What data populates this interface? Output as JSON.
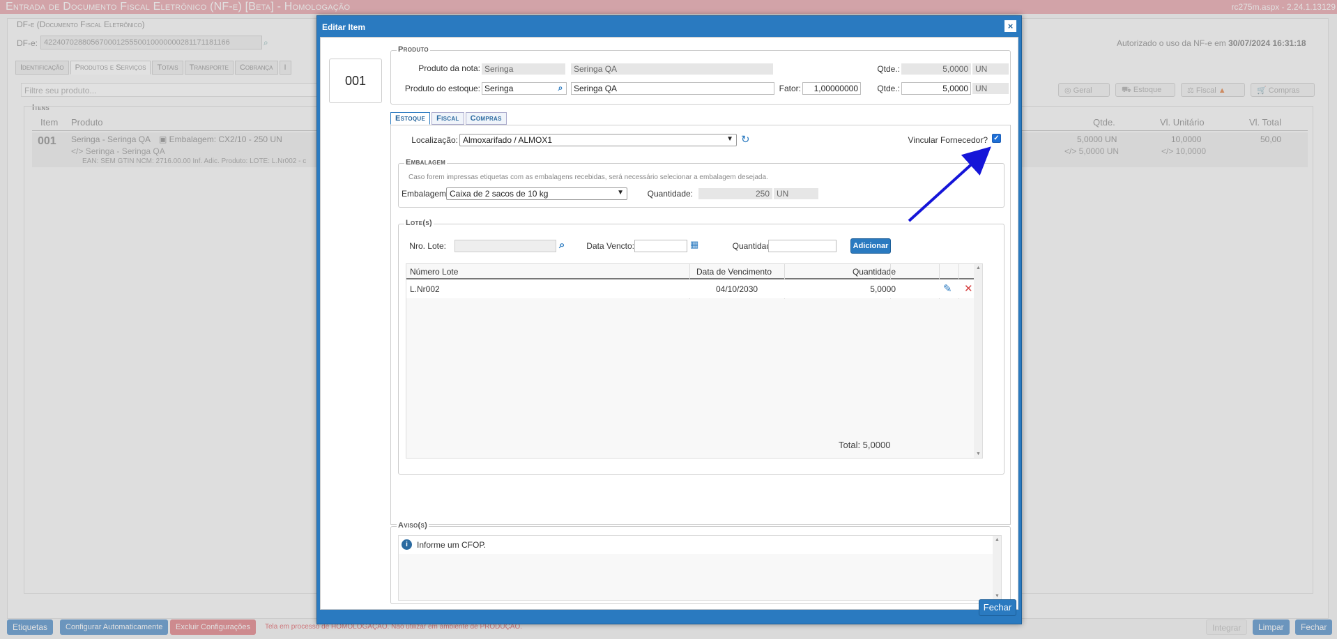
{
  "app": {
    "title": "Entrada de Documento Fiscal Eletrônico (NF-e) [Beta]   - Homologação",
    "version": "rc275m.aspx - 2.24.1.13129",
    "dfe_legend": "DF-e (Documento Fiscal Eletrônico)",
    "dfe_label": "DF-e:",
    "dfe_value": "42240702880567000125550010000000281171181166",
    "authorized_text": "Autorizado o uso da NF-e em",
    "authorized_date": "30/07/2024 16:31:18",
    "tabs": [
      "Identificação",
      "Produtos e Serviços",
      "Totais",
      "Transporte",
      "Cobrança",
      "I"
    ],
    "filter_placeholder": "Filtre seu produto...",
    "itens_legend": "Itens",
    "grid_headers": {
      "item": "Item",
      "produto": "Produto",
      "qtde": "Qtde.",
      "vl_unitario": "Vl. Unitário",
      "vl_total": "Vl. Total"
    },
    "row": {
      "item": "001",
      "produto": "Seringa - Seringa QA",
      "embalagem": "Embalagem: CX2/10 - 250 UN",
      "produto2": "</> Seringa - Seringa QA",
      "ean_line": "EAN: SEM GTIN NCM: 2716.00.00 Inf. Adic. Produto: LOTE: L.Nr002 - c",
      "qtde": "5,0000 UN",
      "qtde2": "</> 5,0000 UN",
      "vl_unitario": "10,0000",
      "vl_unitario2": "</> 10,0000",
      "vl_total": "50,00"
    },
    "view_buttons": [
      "Geral",
      "Estoque",
      "Fiscal",
      "Compras"
    ],
    "footer_buttons": {
      "etiquetas": "Etiquetas",
      "configurar": "Configurar Automaticamente",
      "excluir": "Excluir Configurações",
      "integrar": "Integrar",
      "limpar": "Limpar",
      "fechar": "Fechar"
    },
    "footer_notice": "Tela em processo de HOMOLOGAÇÃO. Não utilizar em ambiente de PRODUÇÃO."
  },
  "modal": {
    "title": "Editar Item",
    "close": "×",
    "item_number": "001",
    "produto": {
      "legend": "Produto",
      "nota_label": "Produto da nota:",
      "nota_code": "Seringa",
      "nota_desc": "Seringa QA",
      "qtde_label": "Qtde.:",
      "nota_qtde": "5,0000",
      "nota_un": "UN",
      "estoque_label": "Produto do estoque:",
      "estoque_code": "Seringa",
      "estoque_desc": "Seringa QA",
      "fator_label": "Fator:",
      "fator": "1,00000000",
      "estoque_qtde": "5,0000",
      "estoque_un": "UN"
    },
    "tabs": [
      "Estoque",
      "Fiscal",
      "Compras"
    ],
    "estoque": {
      "localizacao_label": "Localização:",
      "localizacao_value": "Almoxarifado / ALMOX1",
      "vincular_label": "Vincular Fornecedor?",
      "vincular_checked": true,
      "embalagem_legend": "Embalagem",
      "embalagem_hint": "Caso forem impressas etiquetas com as embalagens recebidas, será necessário selecionar a embalagem desejada.",
      "embalagem_label": "Embalagem:",
      "embalagem_value": "Caixa de 2 sacos de 10 kg",
      "quantidade_label": "Quantidade:",
      "quantidade_value": "250",
      "quantidade_un": "UN",
      "lotes_legend": "Lote(s)",
      "nro_lote_label": "Nro. Lote:",
      "data_vencto_label": "Data Vencto:",
      "lote_qtd_label": "Quantidade:",
      "adicionar": "Adicionar",
      "grid_headers": {
        "numero": "Número Lote",
        "vencimento": "Data de Vencimento",
        "quantidade": "Quantidade"
      },
      "lotes": [
        {
          "numero": "L.Nr002",
          "vencimento": "04/10/2030",
          "quantidade": "5,0000"
        }
      ],
      "total": "Total: 5,0000"
    },
    "aviso": {
      "legend": "Aviso(s)",
      "message": "Informe um CFOP."
    },
    "fechar": "Fechar"
  },
  "annotation": {
    "arrow_color": "#1515d8"
  }
}
